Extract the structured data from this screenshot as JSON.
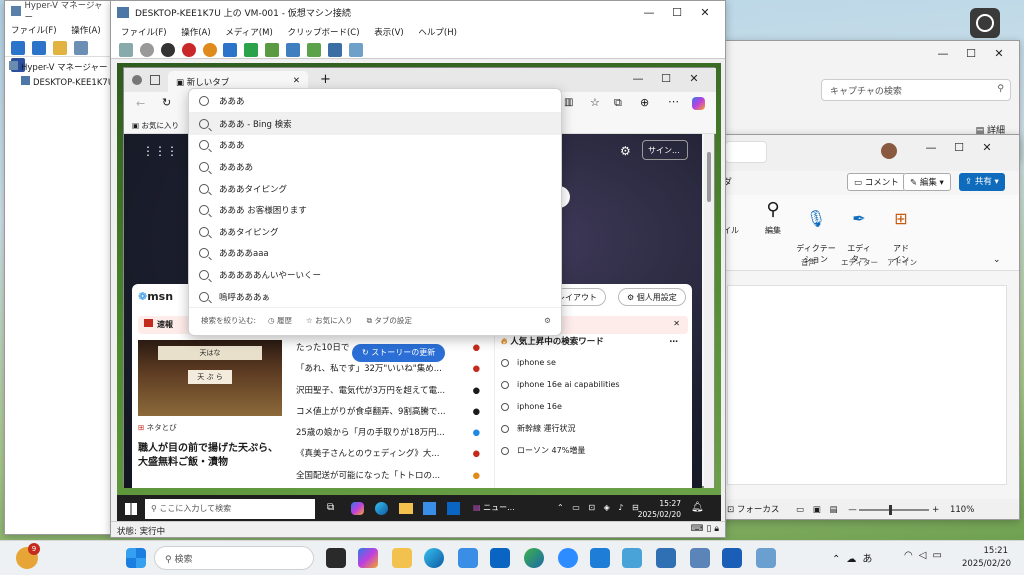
{
  "hyperv": {
    "title": "Hyper-V マネージャー",
    "menu": [
      "ファイル(F)",
      "操作(A)",
      "表"
    ],
    "tree_root": "Hyper-V マネージャー",
    "tree_child": "DESKTOP-KEE1K7U"
  },
  "vm_window": {
    "title": "DESKTOP-KEE1K7U 上の VM-001 - 仮想マシン接続",
    "menu": [
      "ファイル(F)",
      "操作(A)",
      "メディア(M)",
      "クリップボード(C)",
      "表示(V)",
      "ヘルプ(H)"
    ],
    "status": "状態: 実行中"
  },
  "edge": {
    "tab_title": "新しいタブ",
    "favorites": "お気に入り",
    "address_value": "あああ",
    "sign_in": "サイン...",
    "suggestions": [
      "あああ - Bing 検索",
      "あああ",
      "ああああ",
      "あああタイピング",
      "あああ お客様困ります",
      "ああタイピング",
      "ああああaaa",
      "あああああんいやーいくー",
      "嗚呼あああぁ"
    ],
    "suggestion_footer": [
      "検索を絞り込む:",
      "履歴",
      "お気に入り",
      "タブの設定"
    ],
    "msn_logo": "msn",
    "layout_btn": "のレイアウト",
    "personal_btn": "個人用設定",
    "breaking": "速報",
    "story_update": "ストーリーの更新",
    "news_tag": "ネタとび",
    "headline": "職人が目の前で揚げた天ぷら、大盛無料ご飯・漬物",
    "shop_sign_1": "天はな",
    "shop_sign_2": "天 ぷ ら",
    "news_lines": [
      "たった10日で",
      "「あれ、私です」32万\"いいね\"集め...",
      "沢田聖子、電気代が3万円を超えて電...",
      "コメ値上がりが食卓翻弄、9割高騰で...",
      "25歳の娘から「月の手取りが18万円...",
      "《真美子さんとのウェディング》大...",
      "全国配送が可能になった「トトロの..."
    ],
    "trending_title": "人気上昇中の検索ワード",
    "trending": [
      "iphone se",
      "iphone 16e ai capabilities",
      "iphone 16e",
      "新幹線 運行状況",
      "ローソン 47%増量"
    ]
  },
  "vm_taskbar": {
    "search_placeholder": "ここに入力して検索",
    "time": "15:27",
    "date": "2025/02/20",
    "news_label": "ニュー..."
  },
  "capture_window": {
    "search_placeholder": "キャプチャの検索",
    "details": "詳細"
  },
  "word": {
    "comment": "コメント",
    "edit": "編集",
    "share": "共有",
    "groups": [
      {
        "label": "編集",
        "caption": ""
      },
      {
        "label": "ディクテー\nション",
        "caption": "音声"
      },
      {
        "label": "エディ\nター",
        "caption": "エディター"
      },
      {
        "label": "アド\nイン",
        "caption": "アドイン"
      }
    ],
    "focus": "フォーカス",
    "zoom": "110%",
    "partial_labels": [
      "ダ",
      "イル"
    ]
  },
  "host_taskbar": {
    "search_placeholder": "検索",
    "time": "15:21",
    "date": "2025/02/20",
    "ime": "あ",
    "badge_count": "9"
  },
  "colors": {
    "accent": "#0067c0",
    "msn_red": "#c42b1c",
    "story_blue": "#2b6fd6"
  }
}
